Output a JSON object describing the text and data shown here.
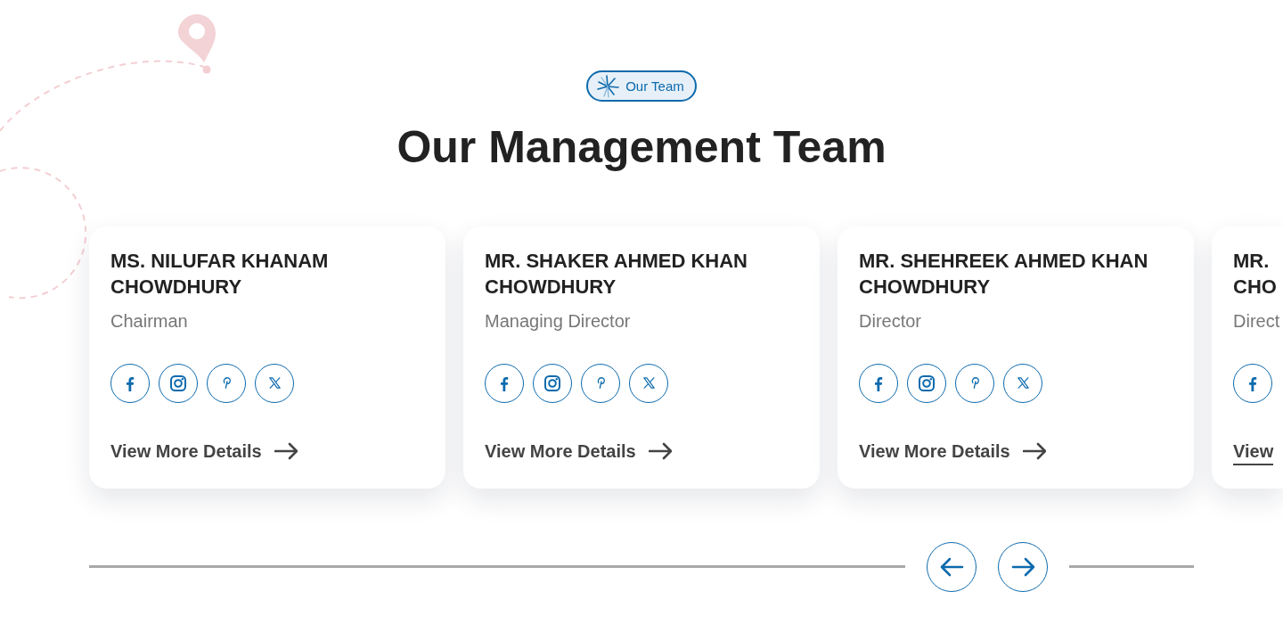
{
  "badge": {
    "label": "Our Team"
  },
  "heading": "Our Management Team",
  "cards": [
    {
      "name": "MS. NILUFAR KHANAM CHOWDHURY",
      "role": "Chairman",
      "socials": [
        {
          "kind": "facebook"
        },
        {
          "kind": "instagram"
        },
        {
          "kind": "pinterest"
        },
        {
          "kind": "x"
        }
      ],
      "link": {
        "text": "View More Details",
        "arrow": true,
        "underlined": false
      },
      "cut": false
    },
    {
      "name": "MR. SHAKER AHMED KHAN CHOWDHURY",
      "role": "Managing Director",
      "socials": [
        {
          "kind": "facebook"
        },
        {
          "kind": "instagram"
        },
        {
          "kind": "pinterest"
        },
        {
          "kind": "x"
        }
      ],
      "link": {
        "text": "View More Details",
        "arrow": true,
        "underlined": false
      },
      "cut": false
    },
    {
      "name": "MR. SHEHREEK AHMED KHAN CHOWDHURY",
      "role": "Director",
      "socials": [
        {
          "kind": "facebook"
        },
        {
          "kind": "instagram"
        },
        {
          "kind": "pinterest"
        },
        {
          "kind": "x"
        }
      ],
      "link": {
        "text": "View More Details",
        "arrow": true,
        "underlined": false
      },
      "cut": false
    },
    {
      "name": "MR. CHO",
      "role": "Direct",
      "socials": [
        {
          "kind": "facebook"
        }
      ],
      "link": {
        "text": "View",
        "arrow": false,
        "underlined": true
      },
      "cut": true
    }
  ]
}
